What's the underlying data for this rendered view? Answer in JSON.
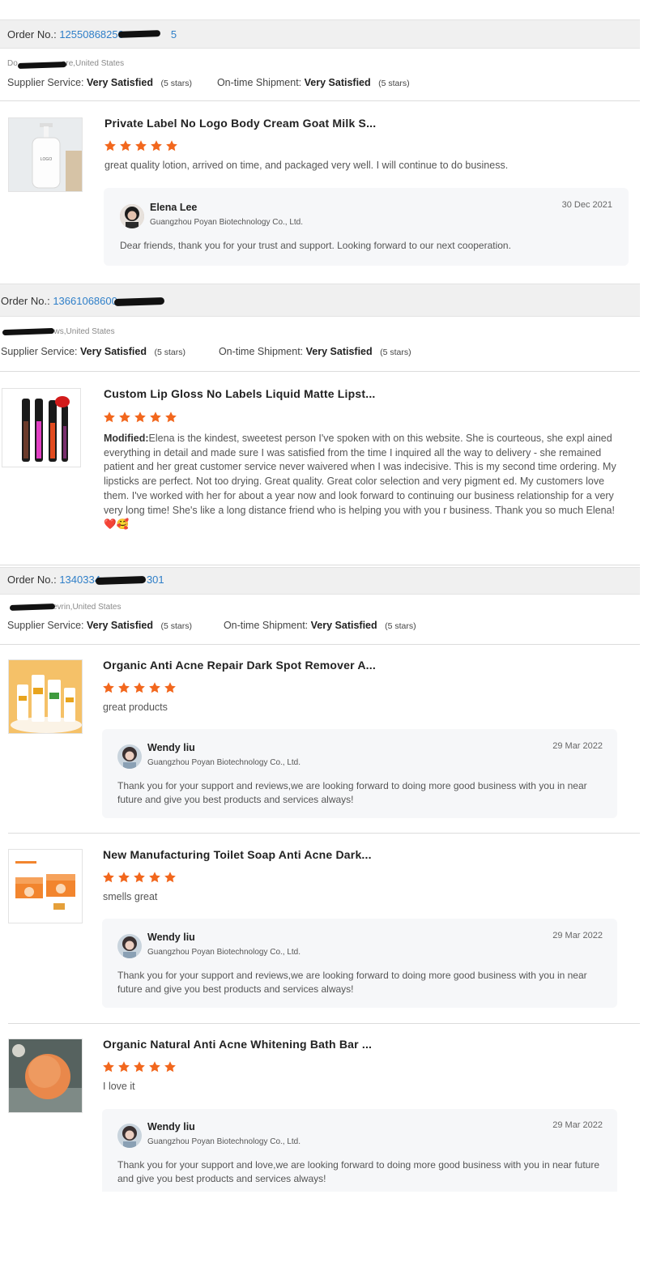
{
  "orders": [
    {
      "order_label": "Order No.:",
      "order_number": "12550868250",
      "order_suffix": "5",
      "buyer_loc_prefix": "Do",
      "buyer_loc": "ore,United States",
      "supplier_service_label": "Supplier Service:",
      "supplier_service_value": "Very Satisfied",
      "supplier_service_stars": "(5 stars)",
      "shipment_label": "On-time Shipment:",
      "shipment_value": "Very Satisfied",
      "shipment_stars": "(5 stars)",
      "products": [
        {
          "title": "Private Label No Logo Body Cream Goat Milk S...",
          "rating": 5,
          "review": "great quality lotion, arrived on time, and packaged very well. I will continue to do business.",
          "image_text": "LOGO",
          "reply": {
            "name": "Elena Lee",
            "company": "Guangzhou Poyan Biotechnology Co., Ltd.",
            "date": "30 Dec 2021",
            "text": "Dear friends, thank you for your trust and support. Looking forward to our next cooperation."
          }
        }
      ]
    },
    {
      "order_label": "Order No.:",
      "order_number": "13661068600",
      "order_suffix": "",
      "buyer_loc_prefix": "",
      "buyer_loc": "ews,United States",
      "supplier_service_label": "Supplier Service:",
      "supplier_service_value": "Very Satisfied",
      "supplier_service_stars": "(5 stars)",
      "shipment_label": "On-time Shipment:",
      "shipment_value": "Very Satisfied",
      "shipment_stars": "(5 stars)",
      "products": [
        {
          "title": "Custom Lip Gloss No Labels Liquid Matte Lipst...",
          "rating": 5,
          "review_prefix": "Modified:",
          "review": "Elena is the kindest, sweetest person I've spoken with on this website. She is courteous, she expl ained everything in detail and made sure I was satisfied from the time I inquired all the way to delivery - she remained patient and her great  customer service never waivered when I was indecisive. This is my second time ordering. My lipsticks are perfect. Not too drying. Great quality. Great color selection and very pigment ed. My customers love them. I've worked with her for about a year now and look forward to continuing our business relationship for a very very long time! She's like a long distance friend who is helping you with you r business. Thank you so much Elena! ❤️🥰"
        }
      ]
    },
    {
      "order_label": "Order No.:",
      "order_number": "1340334",
      "order_suffix": "301",
      "buyer_loc_prefix": "",
      "buyer_loc": "evrin,United States",
      "supplier_service_label": "Supplier Service:",
      "supplier_service_value": "Very Satisfied",
      "supplier_service_stars": "(5 stars)",
      "shipment_label": "On-time Shipment:",
      "shipment_value": "Very Satisfied",
      "shipment_stars": "(5 stars)",
      "products": [
        {
          "title": "Organic Anti Acne Repair Dark Spot Remover A...",
          "rating": 5,
          "review": "great products",
          "reply": {
            "name": "Wendy liu",
            "company": "Guangzhou Poyan Biotechnology Co., Ltd.",
            "date": "29 Mar 2022",
            "text": "Thank you for your support and reviews,we are looking forward to doing more good business with you in near future and give you best products and services always!"
          }
        },
        {
          "title": "New Manufacturing Toilet Soap Anti Acne Dark...",
          "rating": 5,
          "review": "smells great",
          "reply": {
            "name": "Wendy liu",
            "company": "Guangzhou Poyan Biotechnology Co., Ltd.",
            "date": "29 Mar 2022",
            "text": "Thank you for your support and reviews,we are looking forward to doing more good business with you in near future and give you best products and services always!"
          }
        },
        {
          "title": "Organic Natural Anti Acne Whitening Bath Bar ...",
          "rating": 5,
          "review": "I love it",
          "reply": {
            "name": "Wendy liu",
            "company": "Guangzhou Poyan Biotechnology Co., Ltd.",
            "date": "29 Mar 2022",
            "text": "Thank you for your support and love,we are looking forward to doing more good business with you in near future and give you best products and services always!"
          }
        }
      ]
    }
  ],
  "colors": {
    "star": "#f2671d",
    "order_link": "#2f7fc8",
    "header_bg": "#f0f0f0",
    "reply_bg": "#f6f7f9"
  },
  "icons": {
    "star": "star-icon"
  }
}
